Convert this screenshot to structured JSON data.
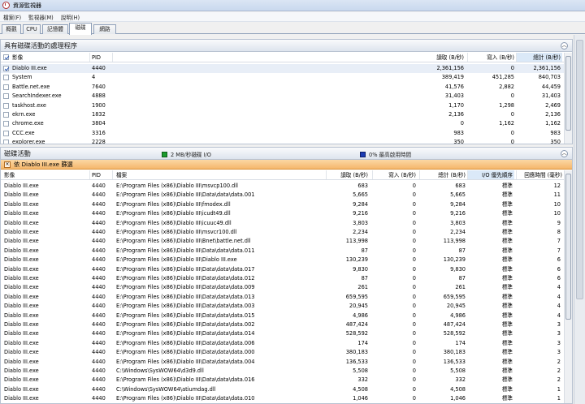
{
  "window": {
    "title": "資源監視器"
  },
  "menu": [
    "檔案(F)",
    "監視器(M)",
    "說明(H)"
  ],
  "tabs": [
    {
      "label": "概觀",
      "active": false
    },
    {
      "label": "CPU",
      "active": false
    },
    {
      "label": "記憶體",
      "active": false
    },
    {
      "label": "磁碟",
      "active": true
    },
    {
      "label": "網路",
      "active": false
    }
  ],
  "processes": {
    "title": "具有磁碟活動的處理程序",
    "columns": {
      "image": "影像",
      "pid": "PID",
      "read": "讀取 (B/秒)",
      "write": "寫入 (B/秒)",
      "total": "總計 (B/秒)"
    },
    "rows": [
      {
        "checked": true,
        "image": "Diablo III.exe",
        "pid": "4440",
        "read": "2,361,156",
        "write": "0",
        "total": "2,361,156"
      },
      {
        "checked": false,
        "image": "System",
        "pid": "4",
        "read": "389,419",
        "write": "451,285",
        "total": "840,703"
      },
      {
        "checked": false,
        "image": "Battle.net.exe",
        "pid": "7640",
        "read": "41,576",
        "write": "2,882",
        "total": "44,459"
      },
      {
        "checked": false,
        "image": "SearchIndexer.exe",
        "pid": "4888",
        "read": "31,403",
        "write": "0",
        "total": "31,403"
      },
      {
        "checked": false,
        "image": "taskhost.exe",
        "pid": "1900",
        "read": "1,170",
        "write": "1,298",
        "total": "2,469"
      },
      {
        "checked": false,
        "image": "ekrn.exe",
        "pid": "1832",
        "read": "2,136",
        "write": "0",
        "total": "2,136"
      },
      {
        "checked": false,
        "image": "chrome.exe",
        "pid": "3804",
        "read": "0",
        "write": "1,162",
        "total": "1,162"
      },
      {
        "checked": false,
        "image": "CCC.exe",
        "pid": "3316",
        "read": "983",
        "write": "0",
        "total": "983"
      },
      {
        "checked": false,
        "image": "explorer.exe",
        "pid": "2228",
        "read": "350",
        "write": "0",
        "total": "350"
      }
    ]
  },
  "disk": {
    "title": "磁碟活動",
    "io_label": "2 MB/秒磁碟 I/O",
    "io_color": "#1a9b2c",
    "active_label": "0% 最高啟用時間",
    "active_color": "#1a3bb4",
    "filter": "依 Diablo III.exe 篩選",
    "columns": {
      "image": "影像",
      "pid": "PID",
      "file": "檔案",
      "read": "讀取 (B/秒)",
      "write": "寫入 (B/秒)",
      "total": "總計 (B/秒)",
      "priority": "I/O 優先順序",
      "response": "回應時間 (毫秒)"
    },
    "rows": [
      {
        "image": "Diablo III.exe",
        "pid": "4440",
        "file": "E:\\Program Files (x86)\\Diablo III\\msvcp100.dll",
        "read": "683",
        "write": "0",
        "total": "683",
        "priority": "標準",
        "response": "12"
      },
      {
        "image": "Diablo III.exe",
        "pid": "4440",
        "file": "E:\\Program Files (x86)\\Diablo III\\Data\\data\\data.001",
        "read": "5,665",
        "write": "0",
        "total": "5,665",
        "priority": "標準",
        "response": "11"
      },
      {
        "image": "Diablo III.exe",
        "pid": "4440",
        "file": "E:\\Program Files (x86)\\Diablo III\\fmodex.dll",
        "read": "9,284",
        "write": "0",
        "total": "9,284",
        "priority": "標準",
        "response": "10"
      },
      {
        "image": "Diablo III.exe",
        "pid": "4440",
        "file": "E:\\Program Files (x86)\\Diablo III\\icudt49.dll",
        "read": "9,216",
        "write": "0",
        "total": "9,216",
        "priority": "標準",
        "response": "10"
      },
      {
        "image": "Diablo III.exe",
        "pid": "4440",
        "file": "E:\\Program Files (x86)\\Diablo III\\icuuc49.dll",
        "read": "3,803",
        "write": "0",
        "total": "3,803",
        "priority": "標準",
        "response": "9"
      },
      {
        "image": "Diablo III.exe",
        "pid": "4440",
        "file": "E:\\Program Files (x86)\\Diablo III\\msvcr100.dll",
        "read": "2,234",
        "write": "0",
        "total": "2,234",
        "priority": "標準",
        "response": "8"
      },
      {
        "image": "Diablo III.exe",
        "pid": "4440",
        "file": "E:\\Program Files (x86)\\Diablo III\\Bnet\\battle.net.dll",
        "read": "113,998",
        "write": "0",
        "total": "113,998",
        "priority": "標準",
        "response": "7"
      },
      {
        "image": "Diablo III.exe",
        "pid": "4440",
        "file": "E:\\Program Files (x86)\\Diablo III\\Data\\data\\data.011",
        "read": "87",
        "write": "0",
        "total": "87",
        "priority": "標準",
        "response": "7"
      },
      {
        "image": "Diablo III.exe",
        "pid": "4440",
        "file": "E:\\Program Files (x86)\\Diablo III\\Diablo III.exe",
        "read": "130,239",
        "write": "0",
        "total": "130,239",
        "priority": "標準",
        "response": "6"
      },
      {
        "image": "Diablo III.exe",
        "pid": "4440",
        "file": "E:\\Program Files (x86)\\Diablo III\\Data\\data\\data.017",
        "read": "9,830",
        "write": "0",
        "total": "9,830",
        "priority": "標準",
        "response": "6"
      },
      {
        "image": "Diablo III.exe",
        "pid": "4440",
        "file": "E:\\Program Files (x86)\\Diablo III\\Data\\data\\data.012",
        "read": "87",
        "write": "0",
        "total": "87",
        "priority": "標準",
        "response": "6"
      },
      {
        "image": "Diablo III.exe",
        "pid": "4440",
        "file": "E:\\Program Files (x86)\\Diablo III\\Data\\data\\data.009",
        "read": "261",
        "write": "0",
        "total": "261",
        "priority": "標準",
        "response": "4"
      },
      {
        "image": "Diablo III.exe",
        "pid": "4440",
        "file": "E:\\Program Files (x86)\\Diablo III\\Data\\data\\data.013",
        "read": "659,595",
        "write": "0",
        "total": "659,595",
        "priority": "標準",
        "response": "4"
      },
      {
        "image": "Diablo III.exe",
        "pid": "4440",
        "file": "E:\\Program Files (x86)\\Diablo III\\Data\\data\\data.003",
        "read": "20,945",
        "write": "0",
        "total": "20,945",
        "priority": "標準",
        "response": "4"
      },
      {
        "image": "Diablo III.exe",
        "pid": "4440",
        "file": "E:\\Program Files (x86)\\Diablo III\\Data\\data\\data.015",
        "read": "4,986",
        "write": "0",
        "total": "4,986",
        "priority": "標準",
        "response": "4"
      },
      {
        "image": "Diablo III.exe",
        "pid": "4440",
        "file": "E:\\Program Files (x86)\\Diablo III\\Data\\data\\data.002",
        "read": "487,424",
        "write": "0",
        "total": "487,424",
        "priority": "標準",
        "response": "3"
      },
      {
        "image": "Diablo III.exe",
        "pid": "4440",
        "file": "E:\\Program Files (x86)\\Diablo III\\Data\\data\\data.014",
        "read": "528,592",
        "write": "0",
        "total": "528,592",
        "priority": "標準",
        "response": "3"
      },
      {
        "image": "Diablo III.exe",
        "pid": "4440",
        "file": "E:\\Program Files (x86)\\Diablo III\\Data\\data\\data.006",
        "read": "174",
        "write": "0",
        "total": "174",
        "priority": "標準",
        "response": "3"
      },
      {
        "image": "Diablo III.exe",
        "pid": "4440",
        "file": "E:\\Program Files (x86)\\Diablo III\\Data\\data\\data.000",
        "read": "380,183",
        "write": "0",
        "total": "380,183",
        "priority": "標準",
        "response": "3"
      },
      {
        "image": "Diablo III.exe",
        "pid": "4440",
        "file": "E:\\Program Files (x86)\\Diablo III\\Data\\data\\data.004",
        "read": "136,533",
        "write": "0",
        "total": "136,533",
        "priority": "標準",
        "response": "2"
      },
      {
        "image": "Diablo III.exe",
        "pid": "4440",
        "file": "C:\\Windows\\SysWOW64\\d3d9.dll",
        "read": "5,508",
        "write": "0",
        "total": "5,508",
        "priority": "標準",
        "response": "2"
      },
      {
        "image": "Diablo III.exe",
        "pid": "4440",
        "file": "E:\\Program Files (x86)\\Diablo III\\Data\\data\\data.016",
        "read": "332",
        "write": "0",
        "total": "332",
        "priority": "標準",
        "response": "2"
      },
      {
        "image": "Diablo III.exe",
        "pid": "4440",
        "file": "C:\\Windows\\SysWOW64\\atiumdag.dll",
        "read": "4,508",
        "write": "0",
        "total": "4,508",
        "priority": "標準",
        "response": "1"
      },
      {
        "image": "Diablo III.exe",
        "pid": "4440",
        "file": "E:\\Program Files (x86)\\Diablo III\\Data\\data\\data.010",
        "read": "1,046",
        "write": "0",
        "total": "1,046",
        "priority": "標準",
        "response": "1"
      }
    ]
  }
}
